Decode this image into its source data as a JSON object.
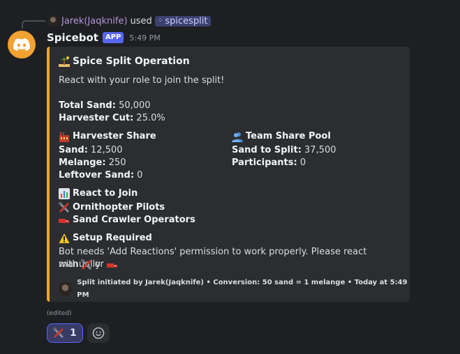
{
  "reply": {
    "user": "Jarek(Jaqknife)",
    "used": "used",
    "command": "spicesplit"
  },
  "message": {
    "bot_name": "Spicebot",
    "badge": "APP",
    "time": "5:49 PM",
    "edited": "(edited)"
  },
  "embed": {
    "accent_color": "#f0a232",
    "title": "Spice Split Operation",
    "title_icon": "desert-island-icon",
    "description": "React with your role to join the split!",
    "total_sand_label": "Total Sand:",
    "total_sand_value": "50,000",
    "harvester_cut_label": "Harvester Cut:",
    "harvester_cut_value": "25.0%",
    "fields": {
      "harvester": {
        "title": "Harvester Share",
        "icon": "factory-icon",
        "sand_label": "Sand:",
        "sand_value": "12,500",
        "melange_label": "Melange:",
        "melange_value": "250",
        "leftover_label": "Leftover Sand:",
        "leftover_value": "0"
      },
      "team": {
        "title": "Team Share Pool",
        "icon": "busts-icon",
        "sand_label": "Sand to Split:",
        "sand_value": "37,500",
        "participants_label": "Participants:",
        "participants_value": "0"
      },
      "react": {
        "title": "React to Join",
        "icon": "bar-chart-icon",
        "role1": "Ornithopter Pilots",
        "role1_icon": "crossed-tools-icon",
        "role2": "Sand Crawler Operators",
        "role2_icon": "truck-icon"
      },
      "setup": {
        "title": "Setup Required",
        "icon": "warning-icon",
        "text": "Bot needs 'Add Reactions' permission to work properly. Please react manually",
        "with": "with",
        "or": "or"
      }
    },
    "footer": "Split initiated by Jarek(Jaqknife) • Conversion: 50 sand = 1 melange • Today at 5:49 PM"
  },
  "reactions": [
    {
      "icon": "crossed-tools-icon",
      "count": "1"
    }
  ]
}
